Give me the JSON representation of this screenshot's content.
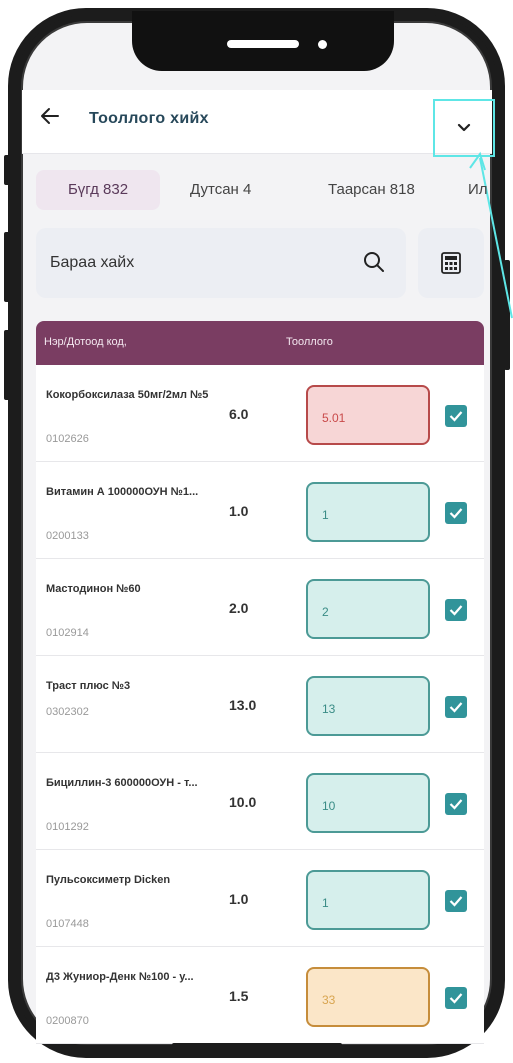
{
  "header": {
    "title": "Тооллого хийх"
  },
  "tabs": [
    {
      "label": "Бүгд 832"
    },
    {
      "label": "Дутсан 4"
    },
    {
      "label": "Таарсан 818"
    },
    {
      "label": "Ил"
    }
  ],
  "search": {
    "placeholder": "Бараа хайх"
  },
  "table": {
    "col_name": "Нэр/Дотоод код,",
    "col_count": "Тооллого",
    "rows": [
      {
        "name": "Кокорбоксилаза 50мг/2мл №5",
        "code": "0102626",
        "qty": "6.0",
        "count": "5.01",
        "state": "err"
      },
      {
        "name": "Витамин А 100000ОУН №1...",
        "code": "0200133",
        "qty": "1.0",
        "count": "1",
        "state": "ok"
      },
      {
        "name": "Мастодинон №60",
        "code": "0102914",
        "qty": "2.0",
        "count": "2",
        "state": "ok"
      },
      {
        "name": "Траст плюс №3",
        "code": "0302302",
        "qty": "13.0",
        "count": "13",
        "state": "ok"
      },
      {
        "name": "Бициллин-3 600000ОУН - т...",
        "code": "0101292",
        "qty": "10.0",
        "count": "10",
        "state": "ok"
      },
      {
        "name": "Пульсоксиметр Dicken",
        "code": "0107448",
        "qty": "1.0",
        "count": "1",
        "state": "ok"
      },
      {
        "name": "Д3 Жуниор-Денк №100 - у...",
        "code": "0200870",
        "qty": "1.5",
        "count": "33",
        "state": "warn"
      }
    ]
  },
  "colors": {
    "accent": "#7a3d62",
    "check": "#31949a",
    "ok_fill": "#d6efec",
    "err_fill": "#f7d6d6",
    "warn_fill": "#fbe6c8",
    "highlight": "#5ee6e6"
  },
  "icons": {
    "back": "arrow-left-icon",
    "dropdown": "chevron-down-icon",
    "search": "search-icon",
    "calculator": "calculator-icon",
    "check": "checkbox-checked-icon"
  }
}
